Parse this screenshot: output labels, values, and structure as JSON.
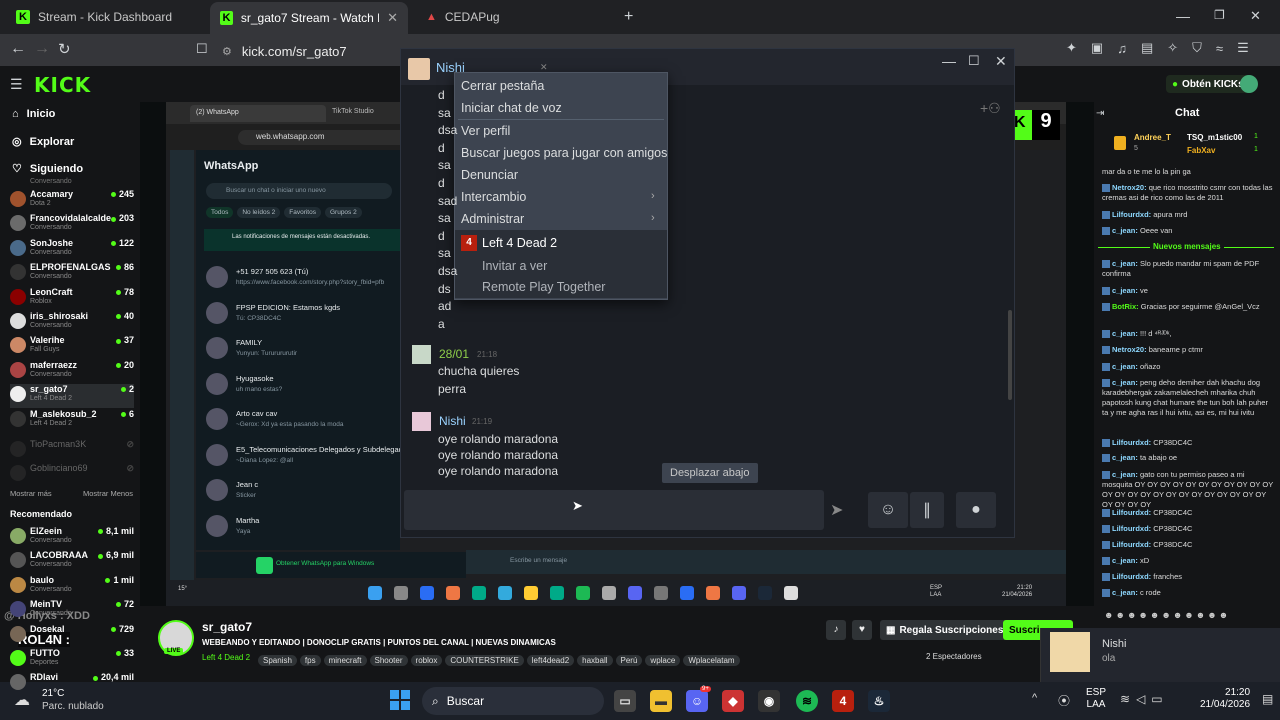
{
  "browser": {
    "tabs": [
      {
        "title": "Stream - Kick Dashboard"
      },
      {
        "title": "sr_gato7 Stream - Watch Live on"
      },
      {
        "title": "CEDAPug"
      }
    ],
    "url": "kick.com/sr_gato7"
  },
  "kick": {
    "logo": "KICK",
    "obtain_kicks": "Obtén KICKs",
    "nav": [
      {
        "label": "Inicio",
        "icon": "home-icon"
      },
      {
        "label": "Explorar",
        "icon": "compass-icon"
      },
      {
        "label": "Siguiendo",
        "icon": "heart-icon"
      }
    ],
    "following_top_game": "Conversando",
    "following": [
      {
        "name": "Accamary",
        "game": "Dota 2",
        "viewers": "245",
        "color": "#a0522d"
      },
      {
        "name": "Francovidalalcalde",
        "game": "Conversando",
        "viewers": "203",
        "color": "#6b6b6b"
      },
      {
        "name": "SonJoshe",
        "game": "Conversando",
        "viewers": "122",
        "color": "#4a6a8a"
      },
      {
        "name": "ELPROFENALGAS",
        "game": "Conversando",
        "viewers": "86",
        "color": "#333"
      },
      {
        "name": "LeonCraft",
        "game": "Roblox",
        "viewers": "78",
        "color": "#8b0000"
      },
      {
        "name": "iris_shirosaki",
        "game": "Conversando",
        "viewers": "40",
        "color": "#ddd"
      },
      {
        "name": "Valerihe",
        "game": "Fall Guys",
        "viewers": "37",
        "color": "#c86"
      },
      {
        "name": "maferraezz",
        "game": "Conversando",
        "viewers": "20",
        "color": "#a44"
      },
      {
        "name": "sr_gato7",
        "game": "Left 4 Dead 2",
        "viewers": "2",
        "color": "#eee"
      },
      {
        "name": "M_aslekosub_2",
        "game": "Left 4 Dead 2",
        "viewers": "6",
        "color": "#333"
      }
    ],
    "offline": [
      {
        "name": "TioPacman3K"
      },
      {
        "name": "Goblinciano69"
      }
    ],
    "show_more": "Mostrar más",
    "show_less": "Mostrar Menos",
    "recommended_title": "Recomendado",
    "recommended": [
      {
        "name": "ElZeein",
        "game": "Conversando",
        "viewers": "8,1 mil",
        "color": "#8a6"
      },
      {
        "name": "LACOBRAAA",
        "game": "Conversando",
        "viewers": "6,9 mil",
        "color": "#555"
      },
      {
        "name": "baulo",
        "game": "Conversando",
        "viewers": "1 mil",
        "color": "#b84"
      },
      {
        "name": "MeinTV",
        "game": "Conversando",
        "viewers": "72",
        "color": "#447"
      },
      {
        "name": "Dosekal",
        "game": "",
        "viewers": "729",
        "color": "#765"
      },
      {
        "name": "FUTTO",
        "game": "Deportes",
        "viewers": "33",
        "color": "#53fc18"
      },
      {
        "name": "RDlavi",
        "game": "",
        "viewers": "20,4 mil",
        "color": "#666"
      }
    ],
    "overlay_text_1": "@ Hollyxs : XDD",
    "overlay_text_2": "ROL4N :"
  },
  "whatsapp": {
    "tab1": "(2) WhatsApp",
    "tab2": "TikTok Studio",
    "url": "web.whatsapp.com",
    "title": "WhatsApp",
    "search_placeholder": "Buscar un chat o iniciar uno nuevo",
    "filters": [
      "Todos",
      "No leídos 2",
      "Favoritos",
      "Grupos 2"
    ],
    "notif": "Las notificaciones de mensajes están desactivadas.",
    "chats": [
      {
        "name": "+51 927 505 623 (Tú)",
        "preview": "https://www.facebook.com/story.php?story_fbid=pfb"
      },
      {
        "name": "FPSP EDICION: Estamos kgds",
        "preview": "Tú: CP38DC4C"
      },
      {
        "name": "FAMILY",
        "preview": "Yunyun: Tururururutir"
      },
      {
        "name": "Hyugasoke",
        "preview": "uh mano estas?"
      },
      {
        "name": "Arto cav cav",
        "preview": "~Gerox: Xd ya esta pasando la moda"
      },
      {
        "name": "E5_Telecomunicaciones Delegados y Subdelegados",
        "preview": "~Diana Lopez: @all"
      },
      {
        "name": "Jean c",
        "preview": "Sticker"
      },
      {
        "name": "Martha",
        "preview": "Yaya"
      }
    ],
    "get_windows": "Obtener WhatsApp para Windows",
    "compose_placeholder": "Escribe un mensaje"
  },
  "steam": {
    "friend_name": "Nishi",
    "old_lines": [
      "d",
      "sa",
      "dsa",
      "d",
      "sa",
      "d",
      "sad",
      "sa",
      "d",
      "sa",
      "dsa",
      "ds",
      "ad",
      "a"
    ],
    "messages": [
      {
        "sender": "28/01",
        "time": "21:18",
        "lines": [
          "chucha quieres",
          "perra"
        ]
      },
      {
        "sender": "Nishi",
        "time": "21:19",
        "lines": [
          "oye rolando maradona",
          "oye rolando maradona",
          "oye rolando maradona"
        ]
      }
    ],
    "scroll_down": "Desplazar abajo",
    "context_menu": {
      "items": [
        "Cerrar pestaña",
        "Iniciar chat de voz",
        "Ver perfil",
        "Buscar juegos para jugar con amigos",
        "Denunciar",
        "Intercambio",
        "Administrar"
      ],
      "game": "Left 4 Dead 2",
      "game_items": [
        "Invitar a ver",
        "Remote Play Together"
      ]
    },
    "score": "9"
  },
  "chat": {
    "title": "Chat",
    "leaders": [
      {
        "name": "Andree_T",
        "points": "5"
      },
      {
        "name": "TSQ_m1stic00",
        "points": "1"
      },
      {
        "name": "FabXav",
        "points": "1"
      }
    ],
    "new_messages": "Nuevos mensajes",
    "messages_before": [
      {
        "user": "",
        "text": "mar da o te me lo la pin ga"
      },
      {
        "user": "Netrox20",
        "text": "que rico mosstrito csmr con todas las cremas asi de rico como las de 2011"
      },
      {
        "user": "Lilfourdxd",
        "text": "apura mrd"
      },
      {
        "user": "c_jean",
        "text": "Oeee van"
      }
    ],
    "messages_after": [
      {
        "user": "c_jean",
        "text": "Slo puedo mandar mi spam de PDF confirma"
      },
      {
        "user": "c_jean",
        "text": "ve"
      },
      {
        "user": "BotRix",
        "text": "Gracias por seguirme @AnGel_Vcz"
      },
      {
        "user": "c_jean",
        "text": "!!! d ⁴ᴿᴶᴰᵏ,"
      },
      {
        "user": "Netrox20",
        "text": "baneame p ctmr"
      },
      {
        "user": "c_jean",
        "text": "oñazo"
      },
      {
        "user": "c_jean",
        "text": "peng deho demiher dah khachu dog karadebhergak zakamelalecheh mharika chuh papotosh kung chat humare the tun boh lah puher ta y me agha ras il hui ivitu, asi es, mi hui ivitu"
      },
      {
        "user": "Lilfourdxd",
        "text": "CP38DC4C"
      },
      {
        "user": "c_jean",
        "text": "ta abajo oe"
      },
      {
        "user": "c_jean",
        "text": "gato con tu permiso paseo a mi mosquita OY OY OY OY OY OY OY OY OY OY OY OY OY OY OY OY OY OY OY OY OY OY OY OY OY OY OY OY"
      },
      {
        "user": "Lilfourdxd",
        "text": "CP38DC4C"
      },
      {
        "user": "Lilfourdxd",
        "text": "CP38DC4C"
      },
      {
        "user": "Lilfourdxd",
        "text": "CP38DC4C"
      },
      {
        "user": "c_jean",
        "text": "xD"
      },
      {
        "user": "Lilfourdxd",
        "text": "franches"
      },
      {
        "user": "c_jean",
        "text": "c rode"
      }
    ]
  },
  "stream_info": {
    "streamer": "sr_gato7",
    "live": "LIVE",
    "title": "WEBEANDO Y EDITANDO | DONOCLIP GRATIS | PUNTOS DEL CANAL | NUEVAS DINAMICAS",
    "game": "Left 4 Dead 2",
    "tags": [
      "Spanish",
      "fps",
      "minecraft",
      "Shooter",
      "roblox",
      "COUNTERSTRIKE",
      "left4dead2",
      "haxball",
      "Perú",
      "wplace",
      "Wplacelatam"
    ],
    "regala": "Regala Suscripciones",
    "suscribirse": "Suscri",
    "viewers": "2 Espectadores"
  },
  "toast": {
    "name": "Nishi",
    "message": "ola"
  },
  "taskbar": {
    "weather_temp": "21°C",
    "weather_desc": "Parc. nublado",
    "search": "Buscar",
    "lang1": "ESP",
    "lang2": "LAA",
    "time": "21:20",
    "date": "21/04/2026",
    "inner_time": "21:20",
    "inner_date": "21/04/2026",
    "inner_temp": "15°",
    "discord_badge": "9+"
  }
}
